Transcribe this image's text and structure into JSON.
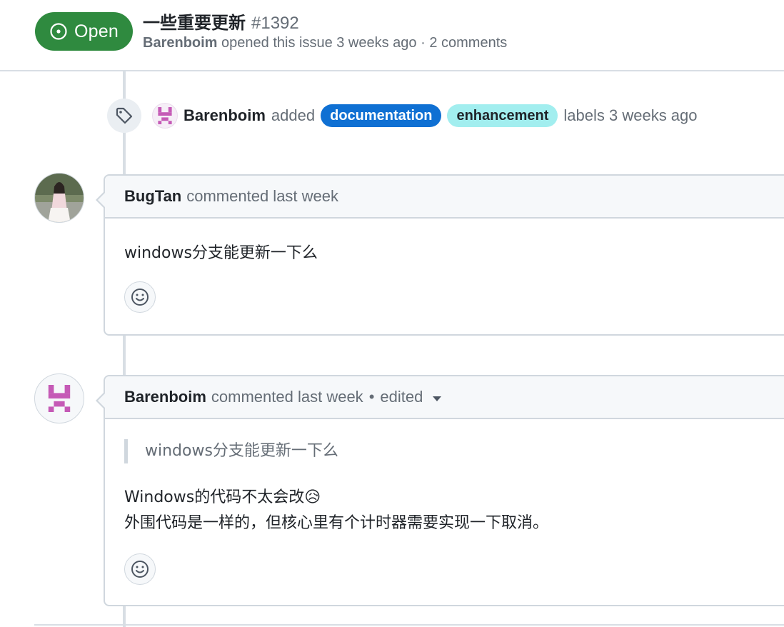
{
  "issue": {
    "status": "Open",
    "status_icon": "issue-opened-icon",
    "title": "一些重要更新",
    "number": "#1392",
    "author": "Barenboim",
    "opened_text": "opened this issue 3 weeks ago · 2 comments"
  },
  "label_event": {
    "icon": "tag-icon",
    "author": "Barenboim",
    "action": "added",
    "labels": [
      "documentation",
      "enhancement"
    ],
    "suffix": "labels 3 weeks ago"
  },
  "comments": [
    {
      "author": "BugTan",
      "meta": "commented last week",
      "body": "windows分支能更新一下么"
    },
    {
      "author": "Barenboim",
      "meta": "commented last week",
      "edited": "edited",
      "quote": "windows分支能更新一下么",
      "line1": "Windows的代码不太会改😥",
      "line2": "外围代码是一样的，但核心里有个计时器需要实现一下取消。"
    }
  ],
  "colors": {
    "open_green": "#2f8a3f",
    "documentation_label": "#0f70d3",
    "enhancement_label": "#a2eeef",
    "identicon_pink": "#c55ab6"
  }
}
